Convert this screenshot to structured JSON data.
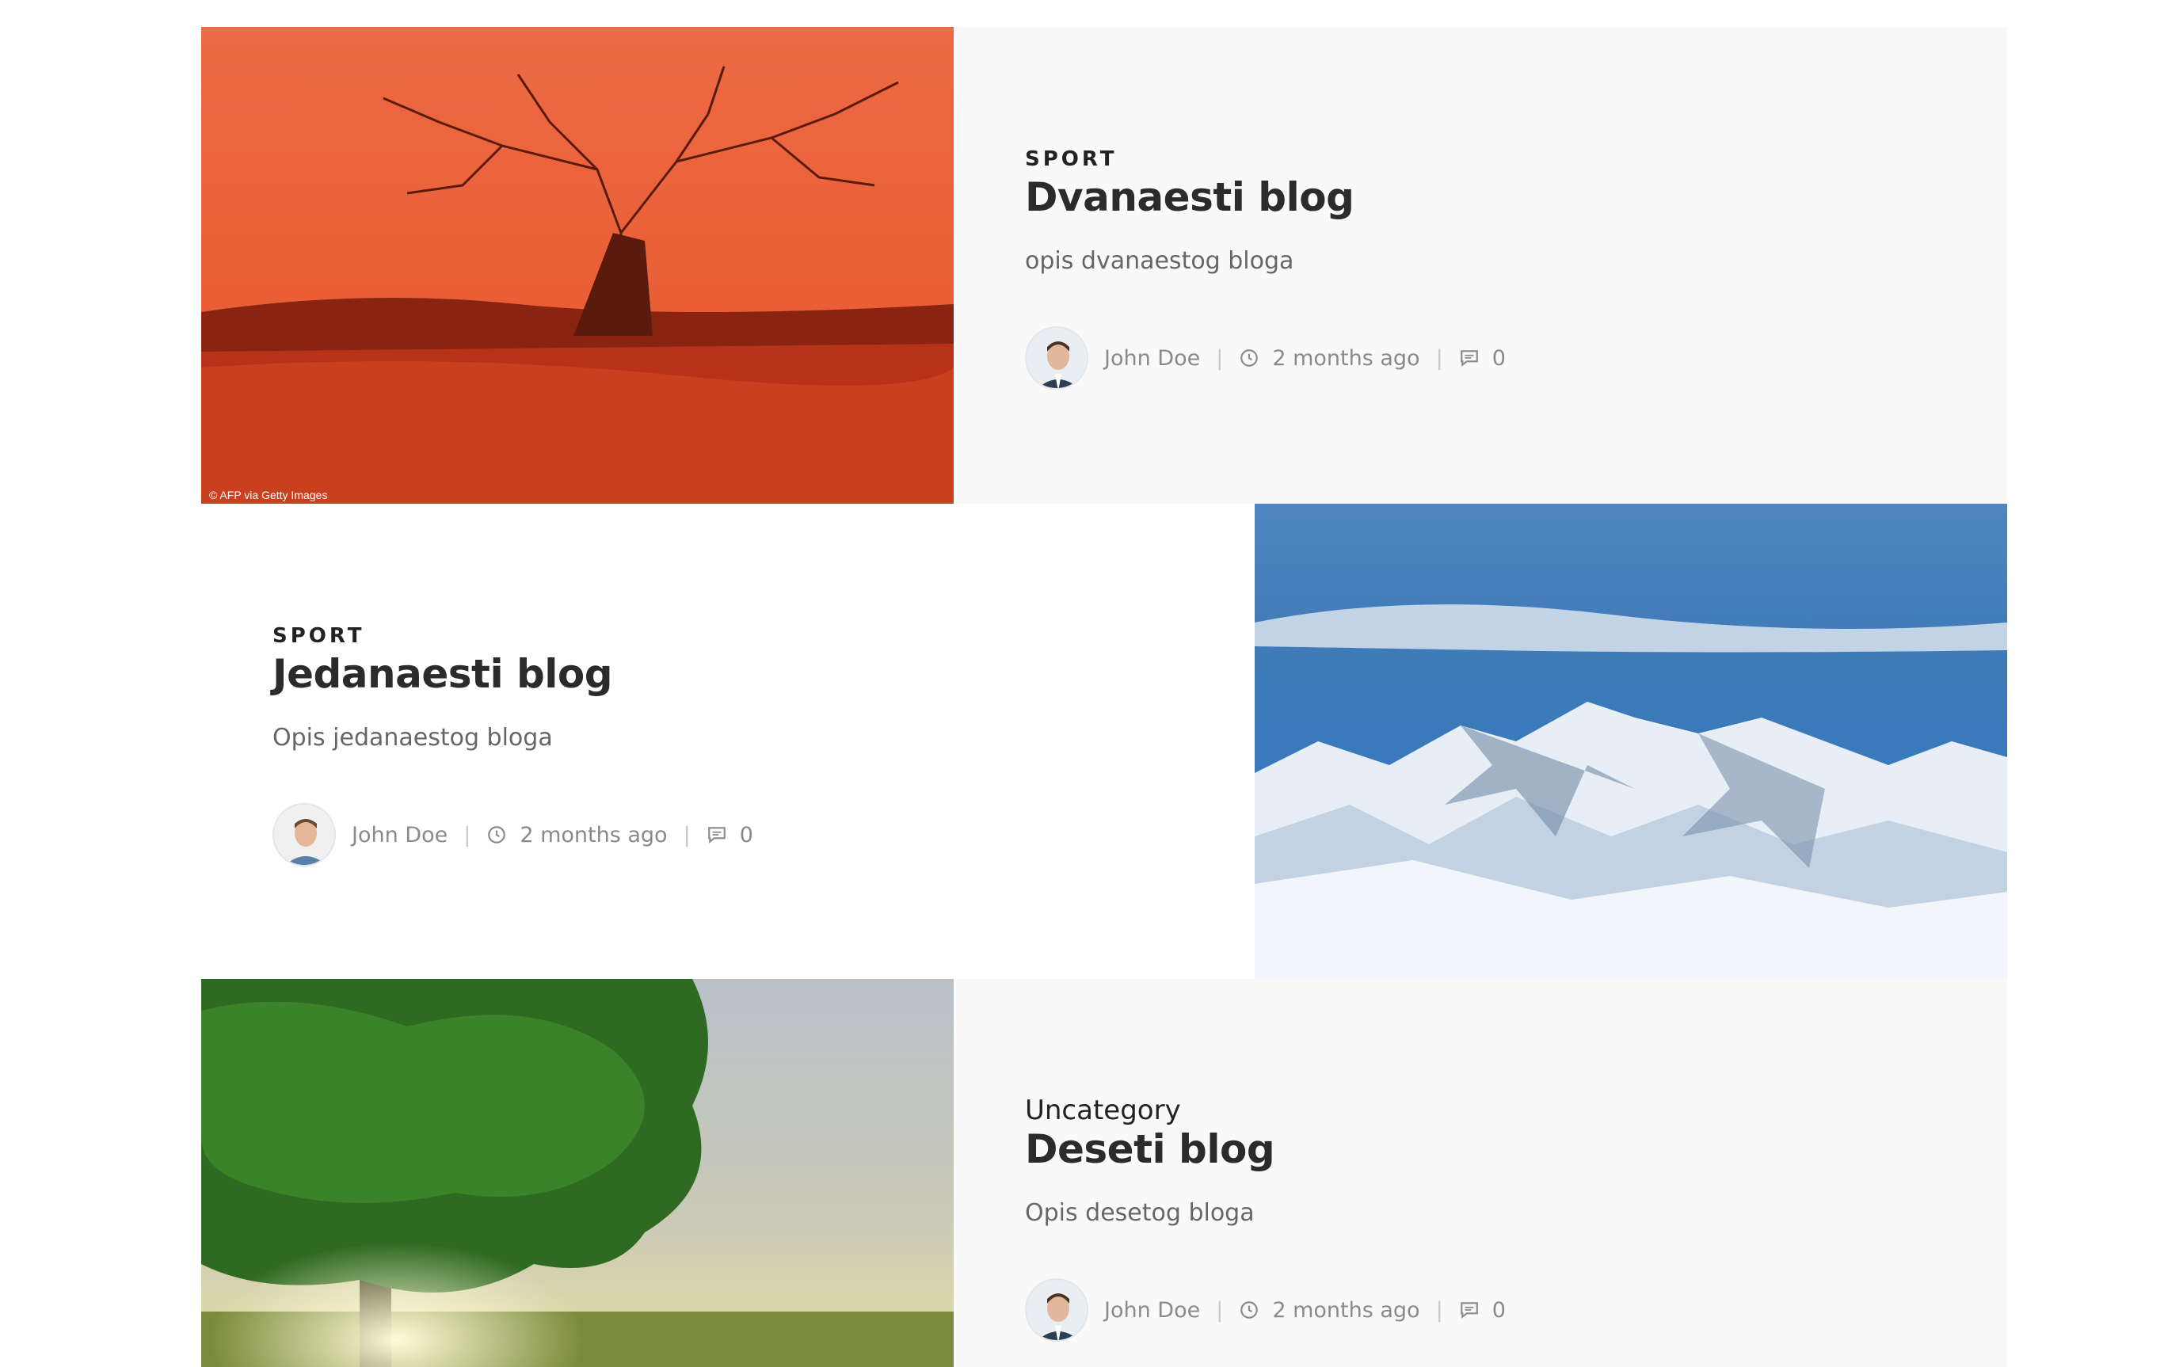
{
  "posts": [
    {
      "category": "SPORT",
      "title": "Dvanaesti blog",
      "excerpt": "opis dvanaestog bloga",
      "author": "John Doe",
      "time": "2 months ago",
      "comments": "0",
      "image_caption": "© AFP via Getty Images"
    },
    {
      "category": "SPORT",
      "title": "Jedanaesti blog",
      "excerpt": "Opis jedanaestog bloga",
      "author": "John Doe",
      "time": "2 months ago",
      "comments": "0"
    },
    {
      "category": "Uncategory",
      "title": "Deseti blog",
      "excerpt": "Opis desetog bloga",
      "author": "John Doe",
      "time": "2 months ago",
      "comments": "0"
    }
  ],
  "colors": {
    "title": "#2b2b2b",
    "meta": "#8a8a8a",
    "card_background": "#f9f9f9"
  },
  "icons": {
    "time": "clock-icon",
    "comments": "comment-icon"
  }
}
